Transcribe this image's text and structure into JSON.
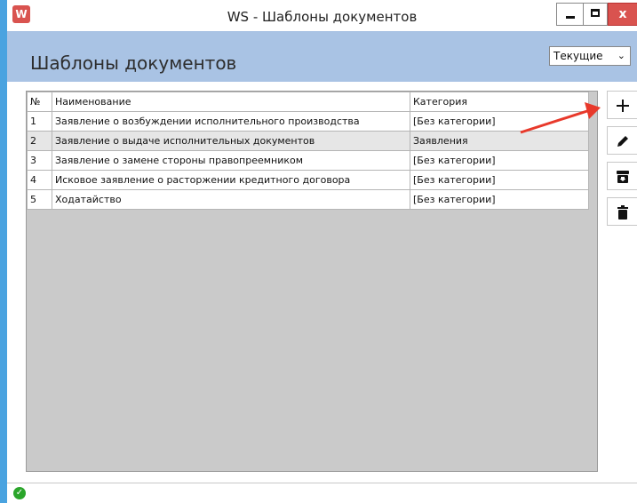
{
  "window": {
    "title": "WS - Шаблоны документов",
    "icon_letter": "W",
    "close_glyph": "x"
  },
  "header": {
    "page_title": "Шаблоны документов",
    "filter_select": {
      "selected": "Текущие",
      "chevron": "⌄"
    }
  },
  "table": {
    "columns": [
      "№",
      "Наименование",
      "Категория"
    ],
    "rows": [
      {
        "num": "1",
        "name": "Заявление о возбуждении исполнительного производства",
        "category": "[Без категории]"
      },
      {
        "num": "2",
        "name": "Заявление о выдаче исполнительных документов",
        "category": "Заявления"
      },
      {
        "num": "3",
        "name": "Заявление о замене стороны правопреемником",
        "category": "[Без категории]"
      },
      {
        "num": "4",
        "name": "Исковое заявление о расторжении кредитного договора",
        "category": "[Без категории]"
      },
      {
        "num": "5",
        "name": "Ходатайство",
        "category": "[Без категории]"
      }
    ]
  },
  "toolbar": {
    "buttons": [
      {
        "name": "add-button",
        "icon": "plus-icon"
      },
      {
        "name": "edit-button",
        "icon": "pencil-icon"
      },
      {
        "name": "archive-button",
        "icon": "archive-icon"
      },
      {
        "name": "delete-button",
        "icon": "trash-icon"
      }
    ]
  },
  "status": {
    "icon": "check-icon",
    "glyph": "✓"
  },
  "colors": {
    "header_bg": "#a9c3e4",
    "window_border": "#4aa3e0",
    "arrow": "#e8392b",
    "close_btn": "#d9534f",
    "status_ok": "#2aa52a"
  }
}
